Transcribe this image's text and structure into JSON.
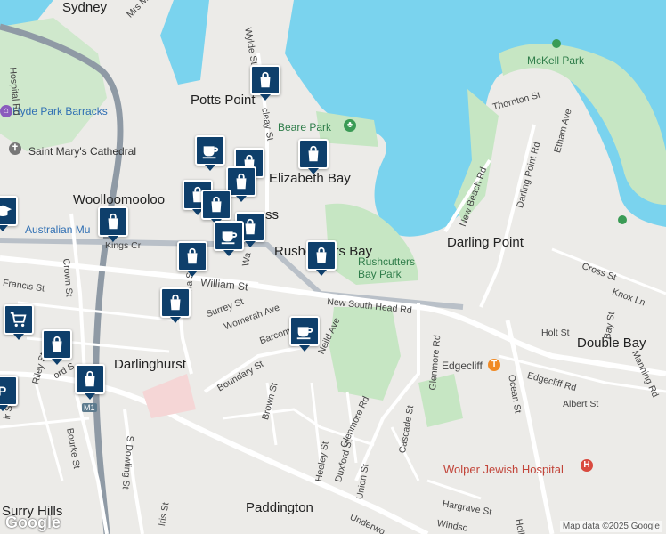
{
  "areas": {
    "sydney": "Sydney",
    "potts_point": "Potts Point",
    "elizabeth_bay": "Elizabeth Bay",
    "woolloomooloo": "Woolloomooloo",
    "rushcutters_bay": "Rushcutters Bay",
    "darling_point": "Darling Point",
    "double_bay": "Double Bay",
    "darlinghurst": "Darlinghurst",
    "paddington": "Paddington",
    "surry_hills": "Surry Hills",
    "edgecliff": "Edgecliff",
    "kings_cross_fragment": "Kings Cr",
    "ss_fragment": "ss"
  },
  "parks": {
    "mckell_park": "McKell Park",
    "beare_park": "Beare Park",
    "rushcutters_bay_park": "Rushcutters Bay Park"
  },
  "pois": {
    "hyde_park_barracks": "Hyde Park Barracks",
    "saint_marys": "Saint Mary's Cathedral",
    "australian_museum": "Australian Mu",
    "wolper_hospital": "Wolper Jewish Hospital"
  },
  "streets": {
    "mrs_macquaries": "Mrs Macquaries Rd",
    "hospital_rd": "Hospital Rd",
    "wylde_st": "Wylde St",
    "macleay_st": "cleay St",
    "thornton_st": "Thornton St",
    "ethan_ave": "Etham Ave",
    "darling_point_rd": "Darling Point Rd",
    "new_beach_rd": "New Beach Rd",
    "cross_st": "Cross St",
    "knox_ln": "Knox Ln",
    "bay_st": "Bay St",
    "holt_st": "Holt St",
    "manning_rd": "Manning Rd",
    "edgecliff_rd": "Edgecliff Rd",
    "albert_st": "Albert St",
    "ocean_st": "Ocean St",
    "new_south_head_rd": "New South Head Rd",
    "william_st": "William St",
    "crown_st": "Crown St",
    "francis_st": "Francis St",
    "victoria_st": "Victoria St",
    "surrey_st": "Surrey St",
    "womerah_ave": "Womerah Ave",
    "barcom_ave": "Barcom Ave",
    "neild_ave": "Neild Ave",
    "boundary_st": "Boundary St",
    "glenmore_rd": "Glenmore Rd",
    "glenmore_rd_2": "Glenmore Rd",
    "cascade_st": "Cascade St",
    "brown_st": "Brown St",
    "heeley_st": "Heeley St",
    "duxford_st": "Duxford St",
    "union_st": "Union St",
    "hargrave_st": "Hargrave St",
    "windsor_st": "Windso",
    "riley_st": "Riley St",
    "bourke_st": "Bourke St",
    "s_dowling_st": "S Dowling St",
    "oxford_fragment": "ord S",
    "iris_st": "Iris St",
    "underwood": "Underwo",
    "holl_st": "Holl",
    "walker_fragment": "Wa",
    "ir_st": "ir St",
    "m1": "M1"
  },
  "branding": {
    "logo": "Google",
    "attribution": "Map data ©2025 Google"
  },
  "colors": {
    "water": "#7ad3ee",
    "park": "#c6e6c3",
    "land": "#ecebe8",
    "road": "#ffffff",
    "motorway": "#8f9aa5",
    "marker": "#0e3f6b"
  },
  "markers": [
    {
      "type": "shopping-bag"
    },
    {
      "type": "shopping-bag"
    },
    {
      "type": "cafe-cup"
    },
    {
      "type": "shopping-bag"
    },
    {
      "type": "shopping-bag"
    },
    {
      "type": "shopping-bag"
    },
    {
      "type": "shopping-bag"
    },
    {
      "type": "shopping-bag"
    },
    {
      "type": "shopping-bag"
    },
    {
      "type": "cafe-cup"
    },
    {
      "type": "shopping-bag"
    },
    {
      "type": "shopping-bag"
    },
    {
      "type": "shopping-bag"
    },
    {
      "type": "cafe-cup"
    },
    {
      "type": "shopping-cart"
    },
    {
      "type": "shopping-bag"
    },
    {
      "type": "shopping-bag"
    },
    {
      "type": "shopping-bag"
    },
    {
      "type": "parking"
    },
    {
      "type": "graduation-cap"
    }
  ]
}
